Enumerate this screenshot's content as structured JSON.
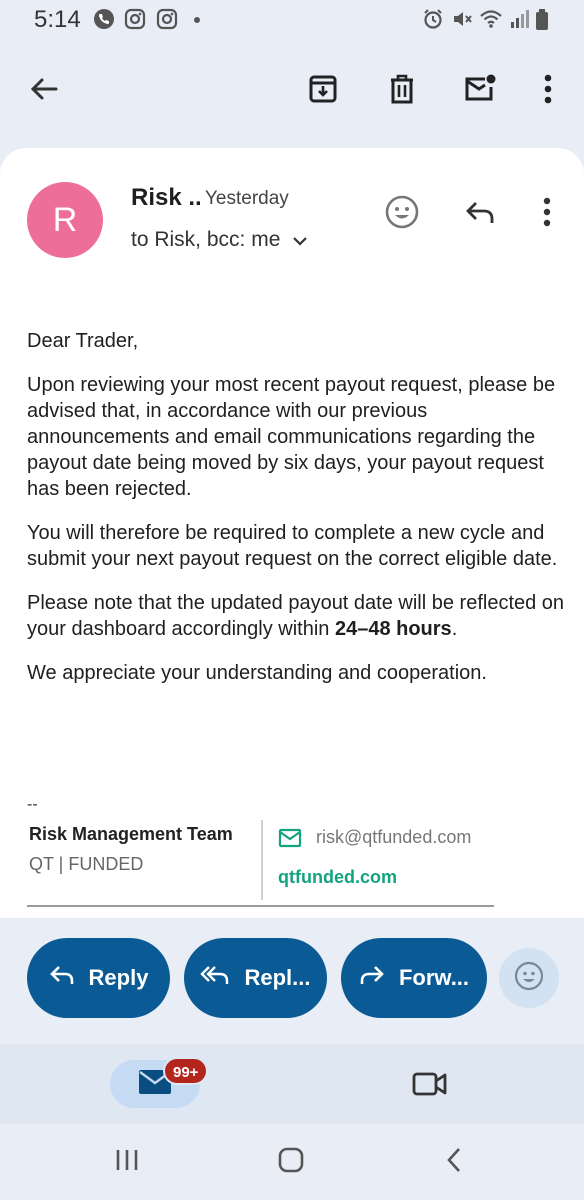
{
  "status_bar": {
    "time": "5:14",
    "left_icons": [
      "phone-call-icon",
      "instagram-icon",
      "instagram-icon"
    ],
    "right_icons": [
      "alarm-icon",
      "mute-icon",
      "wifi-icon",
      "signal-icon",
      "battery-icon"
    ]
  },
  "toolbar": {
    "icons": [
      "back-arrow-icon",
      "archive-icon",
      "delete-icon",
      "mark-unread-icon",
      "more-vert-icon"
    ]
  },
  "email": {
    "avatar_letter": "R",
    "avatar_color": "#ee6e9a",
    "sender": "Risk ..",
    "date": "Yesterday",
    "recipients": "to Risk, bcc: me",
    "body": {
      "greeting": "Dear Trader,",
      "p1": "Upon reviewing your most recent payout request, please be advised that, in accordance with our previous announcements and email communications regarding the payout date being moved by six days, your payout request has been rejected.",
      "p2": "You will therefore be required to complete a new cycle and submit your next payout request on the correct eligible date.",
      "p3_prefix": "Please note that the updated payout date will be reflected on your dashboard accordingly within ",
      "p3_bold": "24–48 hours",
      "p3_suffix": ".",
      "p4": "We appreciate your understanding and cooperation."
    },
    "signature": {
      "dash": "--",
      "team": "Risk Management Team",
      "company": "QT | FUNDED",
      "email": "risk@qtfunded.com",
      "website": "qtfunded.com",
      "website_color": "#14a37f"
    }
  },
  "actions": {
    "reply": "Reply",
    "reply_all": "Repl...",
    "forward": "Forw...",
    "accent_color": "#0a5a96"
  },
  "bottom_nav": {
    "mail_badge": "99+",
    "badge_color": "#b3261e"
  }
}
